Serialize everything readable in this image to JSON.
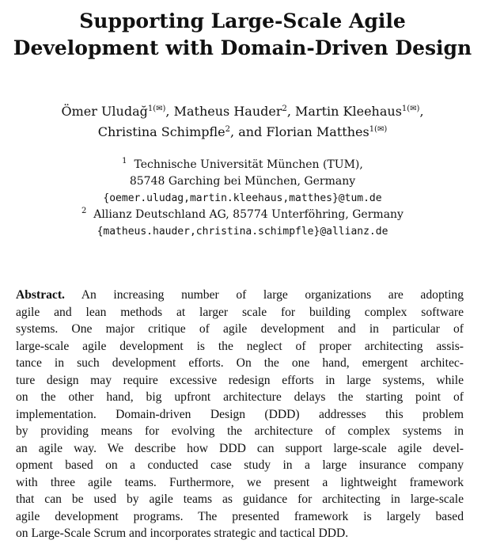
{
  "paper": {
    "title_lines": [
      "Supporting Large-Scale Agile",
      "Development with Domain-Driven Design"
    ],
    "authors": [
      {
        "name": "Ömer Uludağ",
        "sup": "1(✉)",
        "sep": ", "
      },
      {
        "name": "Matheus Hauder",
        "sup": "2",
        "sep": ", "
      },
      {
        "name": "Martin Kleehaus",
        "sup": "1(✉)",
        "sep": ","
      },
      {
        "name": "Christina Schimpfle",
        "sup": "2",
        "sep": ", and "
      },
      {
        "name": "Florian Matthes",
        "sup": "1(✉)",
        "sep": ""
      }
    ],
    "affiliations": [
      {
        "marker": "1",
        "org": "Technische Universität München (TUM),",
        "address": "85748 Garching bei München, Germany",
        "email": "{oemer.uludag,martin.kleehaus,matthes}@tum.de"
      },
      {
        "marker": "2",
        "org": "Allianz Deutschland AG, 85774 Unterföhring, Germany",
        "email": "{matheus.hauder,christina.schimpfle}@allianz.de"
      }
    ],
    "abstract": {
      "label": "Abstract.",
      "lines": [
        "An increasing number of large organizations are adopting",
        "agile and lean methods at larger scale for building complex software",
        "systems. One major critique of agile development and in particular of",
        "large-scale agile development is the neglect of proper architecting assis-",
        "tance in such development efforts. On the one hand, emergent architec-",
        "ture design may require excessive redesign efforts in large systems, while",
        "on the other hand, big upfront architecture delays the starting point of",
        "implementation. Domain-driven Design (DDD) addresses this problem",
        "by providing means for evolving the architecture of complex systems in",
        "an agile way. We describe how DDD can support large-scale agile devel-",
        "opment based on a conducted case study in a large insurance company",
        "with three agile teams. Furthermore, we present a lightweight framework",
        "that can be used by agile teams as guidance for architecting in large-scale",
        "agile development programs. The presented framework is largely based",
        "on Large-Scale Scrum and incorporates strategic and tactical DDD."
      ]
    }
  }
}
